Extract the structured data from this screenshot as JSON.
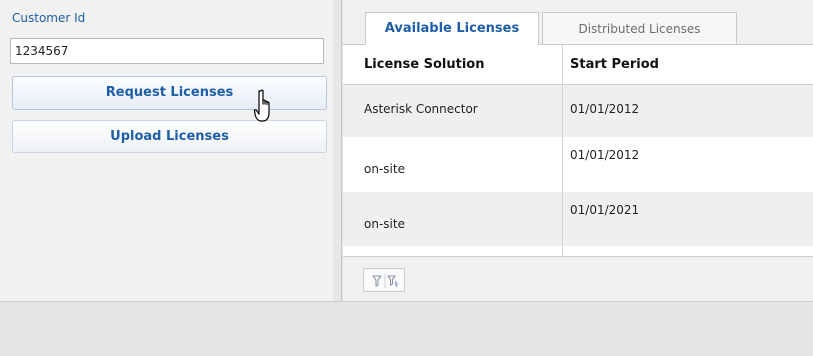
{
  "left": {
    "customer_id_label": "Customer Id",
    "customer_id_value": "1234567",
    "request_button": "Request Licenses",
    "upload_button": "Upload Licenses"
  },
  "tabs": [
    {
      "label": "Available Licenses",
      "active": true
    },
    {
      "label": "Distributed Licenses",
      "active": false
    }
  ],
  "table": {
    "columns": [
      "License Solution",
      "Start Period"
    ],
    "rows": [
      {
        "solution": "Asterisk Connector",
        "start": "01/01/2012"
      },
      {
        "solution": "on-site",
        "start": "01/01/2012"
      },
      {
        "solution": "on-site",
        "start": "01/01/2021"
      },
      {
        "solution": "",
        "start": ""
      }
    ]
  },
  "footer": {
    "filter_icon": "filter-icon",
    "clear_filter_icon": "clear-filter-icon"
  },
  "colors": {
    "accent": "#1f5fa8",
    "row_alt": "#efefef"
  }
}
